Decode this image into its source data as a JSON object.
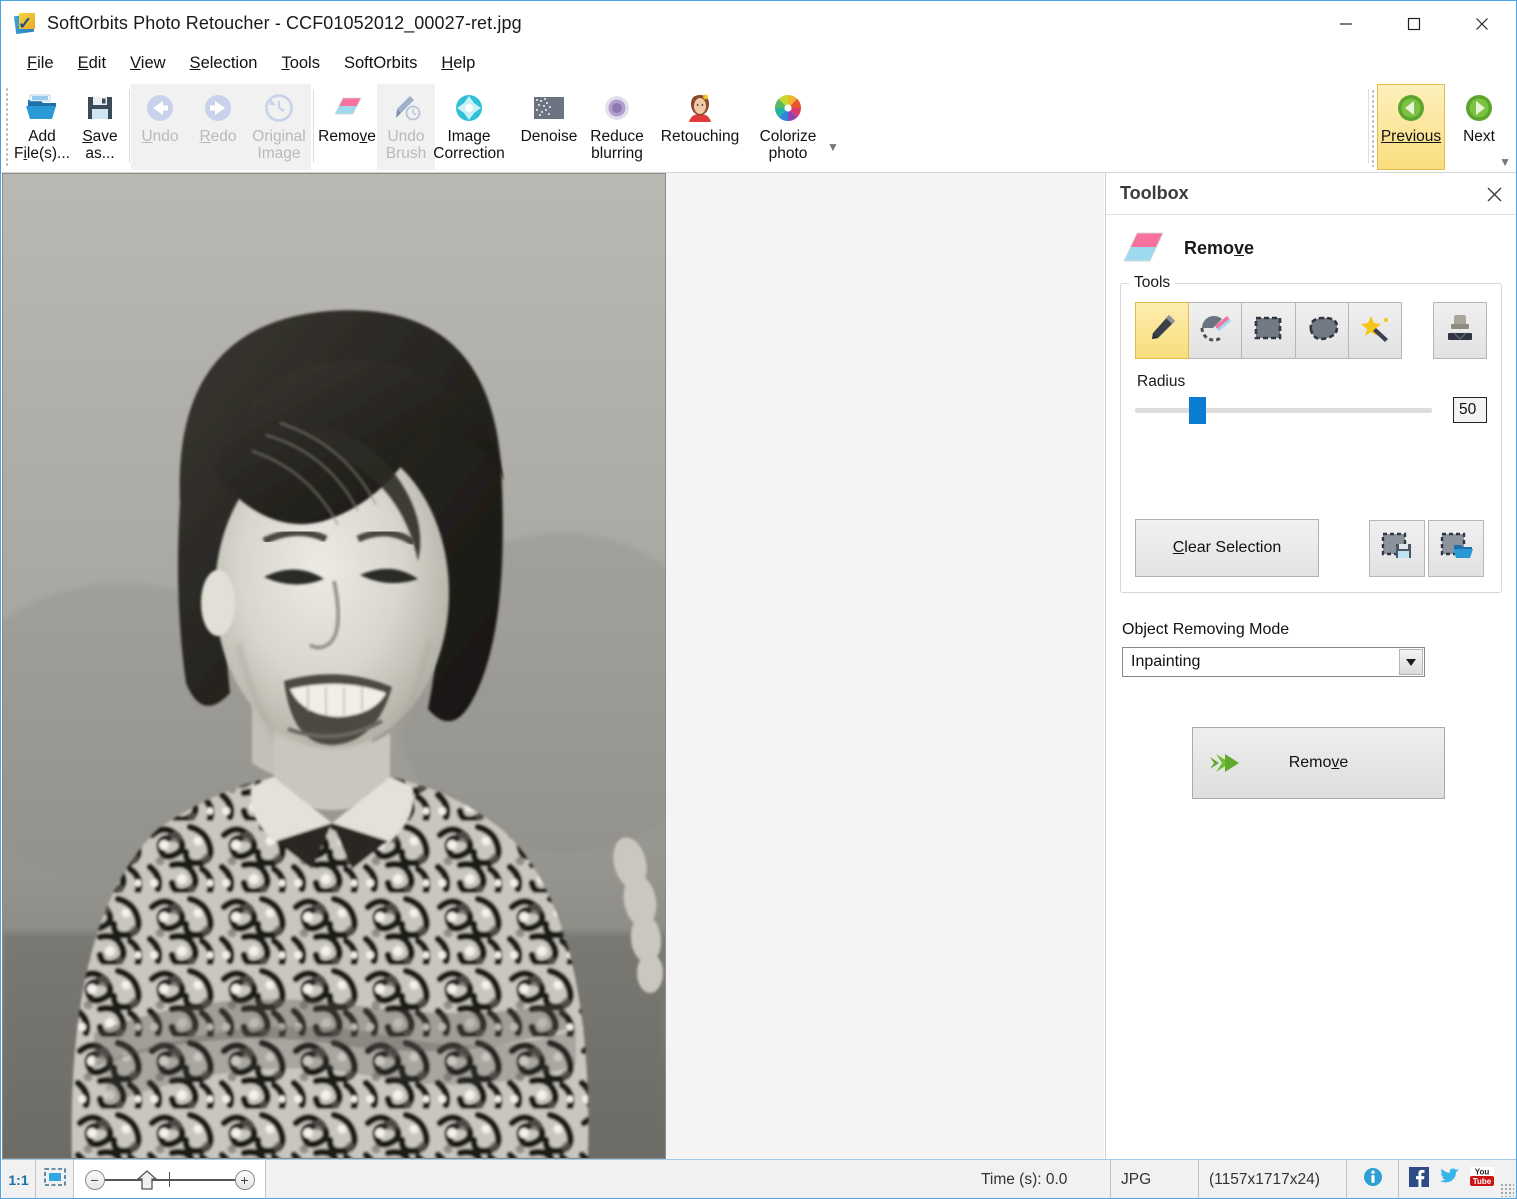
{
  "window": {
    "title": "SoftOrbits Photo Retoucher - CCF01052012_00027-ret.jpg",
    "app_icon": "softorbits-logo-icon",
    "minimize": "minimize-icon",
    "maximize": "maximize-icon",
    "close": "close-icon"
  },
  "menubar": {
    "items": [
      {
        "label": "File",
        "accel": "F"
      },
      {
        "label": "Edit",
        "accel": "E"
      },
      {
        "label": "View",
        "accel": "V"
      },
      {
        "label": "Selection",
        "accel": "S"
      },
      {
        "label": "Tools",
        "accel": "T"
      },
      {
        "label": "SoftOrbits",
        "accel": ""
      },
      {
        "label": "Help",
        "accel": "H"
      }
    ]
  },
  "toolbar": {
    "add_files": {
      "line1": "Add",
      "line2": "File(s)...",
      "icon": "open-folder-icon",
      "disabled": false
    },
    "save_as": {
      "line1": "Save",
      "line2": "as...",
      "icon": "floppy-disk-icon",
      "disabled": false
    },
    "undo": {
      "line1": "Undo",
      "line2": "",
      "icon": "arrow-left-circle-icon",
      "disabled": true
    },
    "redo": {
      "line1": "Redo",
      "line2": "",
      "icon": "arrow-right-circle-icon",
      "disabled": true
    },
    "original_image": {
      "line1": "Original",
      "line2": "Image",
      "icon": "clock-history-icon",
      "disabled": true
    },
    "remove": {
      "line1": "Remove",
      "line2": "",
      "icon": "eraser-icon",
      "disabled": false
    },
    "undo_brush": {
      "line1": "Undo",
      "line2": "Brush",
      "icon": "brush-clock-icon",
      "disabled": true
    },
    "image_correction": {
      "line1": "Image",
      "line2": "Correction",
      "icon": "teal-gem-icon",
      "disabled": false
    },
    "denoise": {
      "line1": "Denoise",
      "line2": "",
      "icon": "noise-grid-icon",
      "disabled": false
    },
    "reduce_blurring": {
      "line1": "Reduce",
      "line2": "blurring",
      "icon": "purple-blur-circle-icon",
      "disabled": false
    },
    "retouching": {
      "line1": "Retouching",
      "line2": "",
      "icon": "woman-portrait-icon",
      "disabled": false
    },
    "colorize_photo": {
      "line1": "Colorize",
      "line2": "photo",
      "icon": "color-wheel-icon",
      "disabled": false
    },
    "previous": {
      "line1": "Previous",
      "line2": "",
      "icon": "green-back-arrow-icon",
      "active": true
    },
    "next": {
      "line1": "Next",
      "line2": "",
      "icon": "green-forward-arrow-icon",
      "active": false
    },
    "overflow": {
      "icon": "toolbar-overflow-chevron-icon"
    }
  },
  "toolbox": {
    "panel_title": "Toolbox",
    "close_icon": "close-icon",
    "mode_icon": "eraser-icon",
    "mode_name": "Remove",
    "mode_name_accel": "v",
    "tools_legend": "Tools",
    "tools": [
      {
        "name": "pencil-tool",
        "icon": "pencil-icon",
        "selected": true
      },
      {
        "name": "eraser-tool",
        "icon": "eraser-selection-icon",
        "selected": false
      },
      {
        "name": "rectangle-select-tool",
        "icon": "marquee-rectangle-icon",
        "selected": false
      },
      {
        "name": "lasso-tool",
        "icon": "lasso-icon",
        "selected": false
      },
      {
        "name": "magic-wand-tool",
        "icon": "magic-wand-icon",
        "selected": false
      },
      {
        "name": "stamp-tool",
        "icon": "clone-stamp-icon",
        "selected": false
      }
    ],
    "radius_label": "Radius",
    "radius_value": "50",
    "radius_percent": 18,
    "clear_selection": "Clear Selection",
    "clear_selection_accel": "C",
    "save_selection_icon": "save-selection-icon",
    "load_selection_icon": "load-selection-icon",
    "object_removing_mode_label": "Object Removing Mode",
    "object_removing_mode_value": "Inpainting",
    "dropdown_icon": "chevron-down-icon",
    "remove_button": "Remove",
    "remove_button_accel": "v",
    "remove_button_icon": "green-double-arrow-icon"
  },
  "statusbar": {
    "zoom_ratio": "1:1",
    "fit_icon": "fit-to-window-icon",
    "zoom_out_icon": "minus-icon",
    "zoom_in_icon": "plus-icon",
    "zoom_home_icon": "home-marker-icon",
    "time": "Time (s): 0.0",
    "format": "JPG",
    "dimensions": "(1157x1717x24)",
    "info_icon": "info-icon",
    "facebook_icon": "facebook-icon",
    "twitter_icon": "twitter-icon",
    "youtube_icon": "youtube-icon",
    "youtube_top": "You",
    "youtube_bottom": "Tube",
    "resize_grip": "resize-grip-icon"
  },
  "canvas": {
    "image_alt": "vintage black and white portrait of a smiling young woman in a patterned paisley blouse with arms crossed"
  }
}
